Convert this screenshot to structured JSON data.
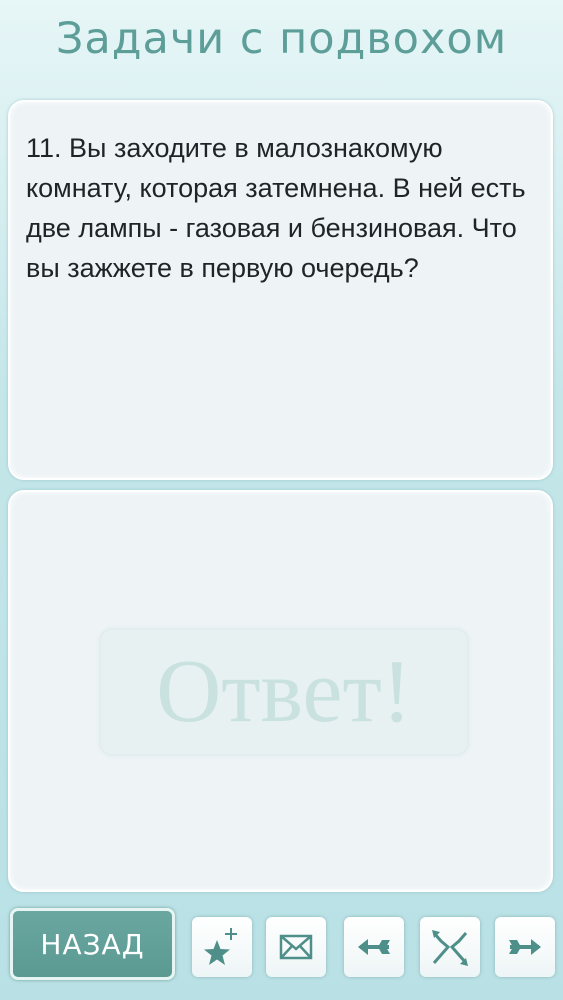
{
  "header": {
    "title": "Задачи с подвохом"
  },
  "question": {
    "text": "11. Вы заходите в малознакомую комнату, которая затемнена. В ней есть две лампы - газовая и бензиновая. Что вы зажжете в первую очередь?"
  },
  "answer": {
    "button_label": "Ответ!"
  },
  "toolbar": {
    "back_label": "НАЗАД",
    "icons": {
      "favorite": "star-plus-icon",
      "mail": "envelope-icon",
      "previous": "arrow-left-icon",
      "random": "shuffle-icon",
      "next": "arrow-right-icon"
    }
  },
  "colors": {
    "accent": "#5e9e99",
    "background": "#c4e6e9",
    "panel": "#eef4f6",
    "back_button": "#6aa7a1",
    "answer_text": "#c9e2df"
  }
}
